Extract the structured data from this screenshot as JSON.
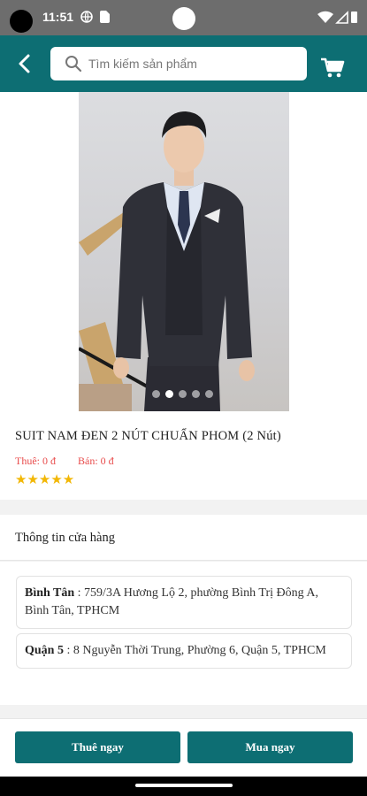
{
  "status_bar": {
    "time": "11:51",
    "icons": [
      "globe-icon",
      "sim-card-icon",
      "wifi-icon",
      "signal-icon",
      "battery-icon"
    ]
  },
  "header": {
    "search_placeholder": "Tìm kiếm sản phẩm",
    "back_icon": "chevron-left-icon",
    "cart_icon": "shopping-cart-icon",
    "color": "#0d6e73"
  },
  "gallery": {
    "image_count": 5,
    "active_index": 1
  },
  "product": {
    "title": "SUIT NAM ĐEN 2 NÚT CHUẨN PHOM (2 Nút)",
    "rent_price": "Thuê: 0 đ",
    "buy_price": "Bán: 0 đ",
    "stars_text": "★★★★★",
    "rating": 5
  },
  "store": {
    "title": "Thông tin cửa hàng",
    "locations": [
      {
        "name": "Bình Tân",
        "address": " : 759/3A Hương Lộ 2, phường Bình Trị Đông A, Bình Tân, TPHCM"
      },
      {
        "name": "Quận 5",
        "address": " : 8 Nguyễn Thời Trung, Phường 6, Quận 5, TPHCM"
      }
    ]
  },
  "actions": {
    "rent_label": "Thuê ngay",
    "buy_label": "Mua ngay"
  },
  "colors": {
    "primary": "#0d6e73",
    "price": "#e84a4a",
    "star": "#f2b705"
  }
}
